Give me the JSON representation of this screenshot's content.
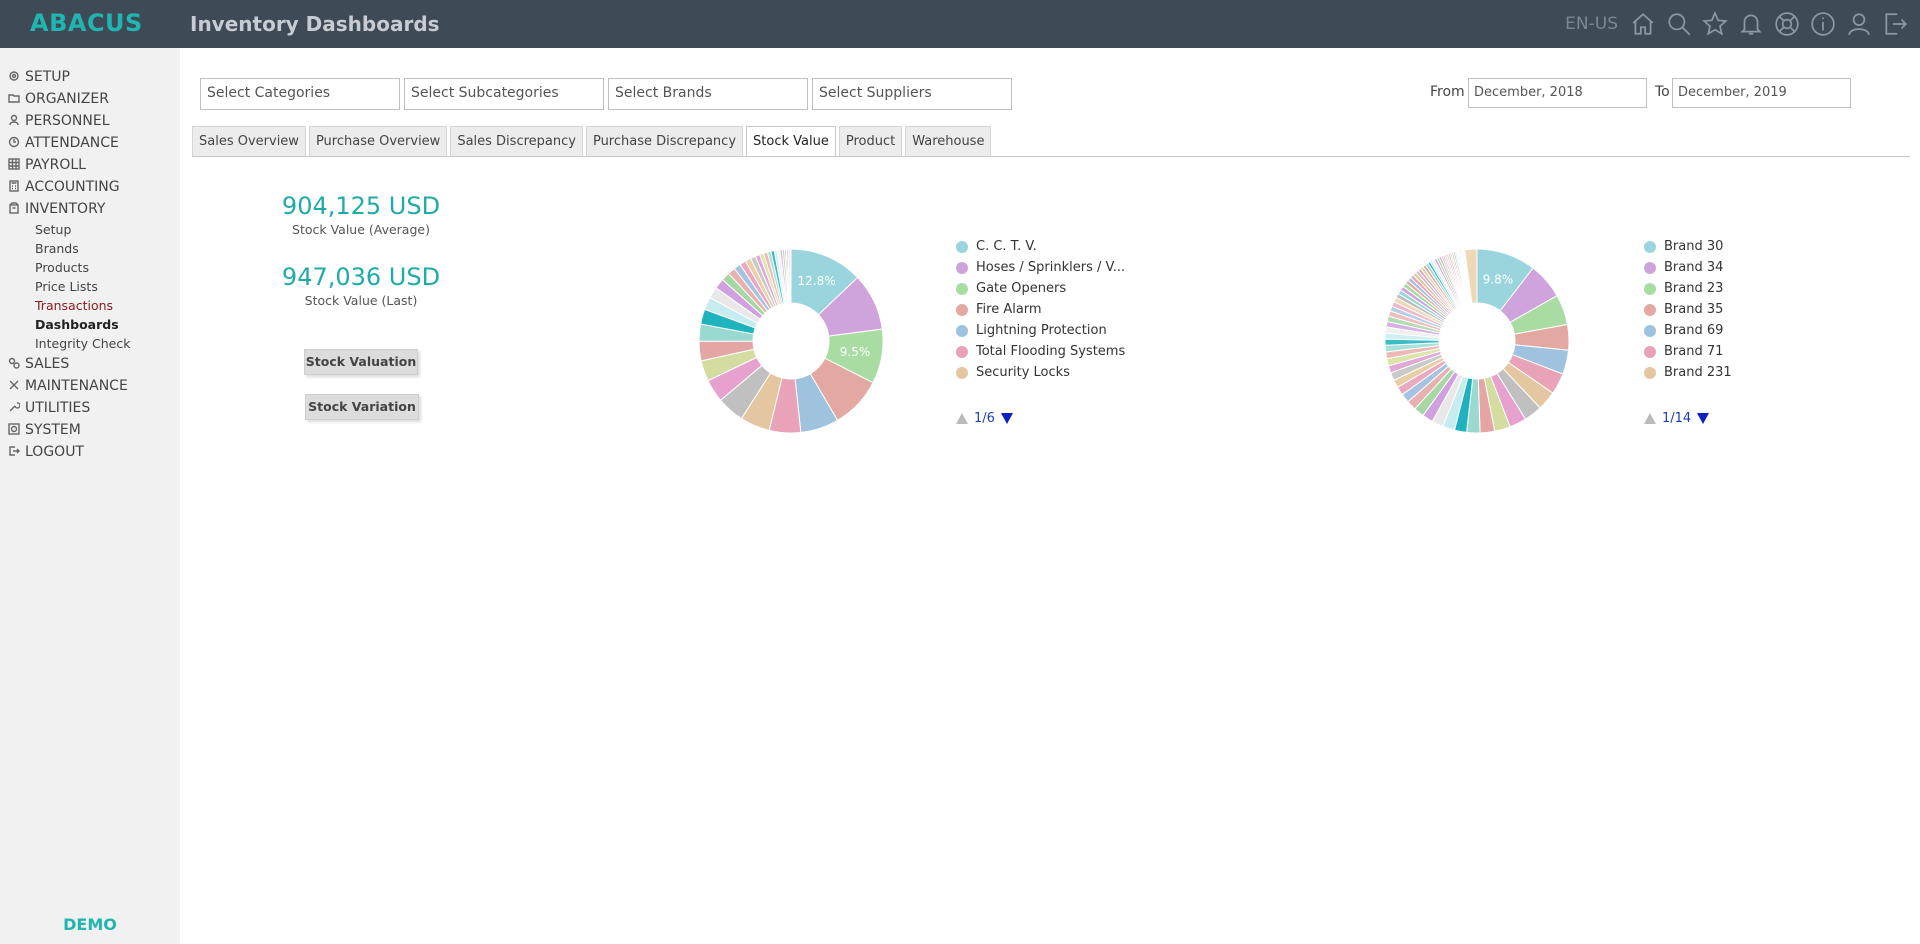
{
  "app": {
    "logo": "ABACUS",
    "title": "Inventory Dashboards",
    "language": "EN-US"
  },
  "topbar_icons": [
    "home-icon",
    "search-icon",
    "star-icon",
    "bell-icon",
    "lifebuoy-icon",
    "info-icon",
    "user-icon",
    "logout-icon"
  ],
  "sidebar": {
    "items": [
      {
        "label": "SETUP",
        "icon": "gear-icon"
      },
      {
        "label": "ORGANIZER",
        "icon": "folder-icon"
      },
      {
        "label": "PERSONNEL",
        "icon": "people-icon"
      },
      {
        "label": "ATTENDANCE",
        "icon": "clock-icon"
      },
      {
        "label": "PAYROLL",
        "icon": "grid-icon"
      },
      {
        "label": "ACCOUNTING",
        "icon": "calculator-icon"
      },
      {
        "label": "INVENTORY",
        "icon": "box-icon"
      },
      {
        "label": "SALES",
        "icon": "gears-icon"
      },
      {
        "label": "MAINTENANCE",
        "icon": "tools-icon"
      },
      {
        "label": "UTILITIES",
        "icon": "wrench-icon"
      },
      {
        "label": "SYSTEM",
        "icon": "system-icon"
      },
      {
        "label": "LOGOUT",
        "icon": "door-icon"
      }
    ],
    "inventory_sub": [
      {
        "label": "Setup"
      },
      {
        "label": "Brands"
      },
      {
        "label": "Products"
      },
      {
        "label": "Price Lists"
      },
      {
        "label": "Transactions"
      },
      {
        "label": "Dashboards"
      },
      {
        "label": "Integrity Check"
      }
    ],
    "footer": "DEMO"
  },
  "filters": {
    "categories_placeholder": "Select Categories",
    "subcategories_placeholder": "Select Subcategories",
    "brands_placeholder": "Select Brands",
    "suppliers_placeholder": "Select Suppliers",
    "from_label": "From",
    "from_value": "December, 2018",
    "to_label": "To",
    "to_value": "December, 2019"
  },
  "tabs": [
    {
      "label": "Sales Overview"
    },
    {
      "label": "Purchase Overview"
    },
    {
      "label": "Sales Discrepancy"
    },
    {
      "label": "Purchase Discrepancy"
    },
    {
      "label": "Stock Value",
      "active": true
    },
    {
      "label": "Product"
    },
    {
      "label": "Warehouse"
    }
  ],
  "kpis": {
    "average_value": "904,125 USD",
    "average_label": "Stock Value (Average)",
    "last_value": "947,036 USD",
    "last_label": "Stock Value (Last)"
  },
  "buttons": {
    "valuation": "Stock Valuation",
    "variation": "Stock Variation"
  },
  "chart_data": [
    {
      "type": "pie",
      "title": "",
      "legend_position": "right",
      "legend_page": "1/6",
      "categories": [
        "C. C. T. V.",
        "Hoses / Sprinklers / V...",
        "Gate Openers",
        "Fire Alarm",
        "Lightning Protection",
        "Total Flooding Systems",
        "Security Locks"
      ],
      "values": [
        12.8,
        10.0,
        9.5,
        9.0,
        6.7,
        5.5,
        5.2,
        4.8,
        4.0,
        3.6,
        3.4,
        3.0,
        2.6,
        2.2,
        2.0,
        1.8,
        1.5,
        1.3,
        1.2,
        1.1,
        1.0,
        0.9,
        0.8,
        0.7,
        0.7,
        0.6,
        0.6,
        0.5,
        0.5,
        0.4,
        0.4,
        0.3,
        0.3,
        0.3,
        0.2
      ],
      "labels_shown": [
        "12.8%",
        "",
        "9.5%"
      ],
      "colors": [
        "#9ad5de",
        "#cfa3db",
        "#a9dca3",
        "#e4a8a3",
        "#9fc2de",
        "#e9a3b8",
        "#e4c7a0",
        "#c0c0c0",
        "#e6a1cf",
        "#d4dca0",
        "#e5a5a5",
        "#9ad9d0",
        "#1fb3bf",
        "#c7ecf0",
        "#e8e8e8",
        "#d1a0df",
        "#a6d7a5",
        "#e7b1b1",
        "#a6c3e0",
        "#eba9c1",
        "#e8cfa6",
        "#c9c9c9",
        "#e3a9d6",
        "#dce4a9",
        "#efb8b8",
        "#a9e0d7",
        "#3bbdc8",
        "#cfeef2",
        "#f0f0f0",
        "#d8b0e3",
        "#b3dcb2",
        "#edc0c0",
        "#b6cfe6",
        "#f0b7cb",
        "#eed8b5"
      ]
    },
    {
      "type": "pie",
      "title": "",
      "legend_position": "right",
      "legend_page": "1/14",
      "categories": [
        "Brand 30",
        "Brand 34",
        "Brand 23",
        "Brand 35",
        "Brand 69",
        "Brand 71",
        "Brand 231"
      ],
      "values": [
        9.8,
        6.0,
        5.0,
        4.2,
        4.0,
        3.5,
        3.2,
        3.0,
        2.8,
        2.6,
        2.4,
        2.2,
        2.0,
        2.0,
        1.9,
        1.8,
        1.7,
        1.6,
        1.5,
        1.4,
        1.3,
        1.3,
        1.2,
        1.2,
        1.1,
        1.1,
        1.0,
        1.0,
        1.0,
        0.9,
        0.9,
        0.9,
        0.8,
        0.8,
        0.8,
        0.7,
        0.7,
        0.7,
        0.7,
        0.6,
        0.6,
        0.6,
        0.6,
        0.5,
        0.5,
        0.5,
        0.5,
        0.5,
        0.4,
        0.4,
        0.4,
        0.4,
        0.4,
        0.4,
        0.3,
        0.3,
        0.3,
        0.3,
        0.3,
        0.3,
        0.3,
        0.3,
        0.2,
        0.2,
        0.2,
        0.2,
        0.2,
        0.2,
        0.2,
        0.2,
        2.0
      ],
      "labels_shown": [
        "9.8%"
      ],
      "colors": [
        "#9ad5de",
        "#cfa3db",
        "#a9dca3",
        "#e4a8a3",
        "#9fc2de",
        "#e9a3b8",
        "#e4c7a0",
        "#c0c0c0",
        "#e6a1cf",
        "#d4dca0",
        "#e5a5a5",
        "#9ad9d0",
        "#1fb3bf",
        "#c7ecf0",
        "#e8e8e8",
        "#d1a0df",
        "#a6d7a5",
        "#e7b1b1",
        "#a6c3e0",
        "#eba9c1",
        "#e8cfa6",
        "#c9c9c9",
        "#e3a9d6",
        "#dce4a9",
        "#efb8b8",
        "#a9e0d7",
        "#3bbdc8",
        "#cfeef2",
        "#f0f0f0",
        "#d8b0e3",
        "#b3dcb2",
        "#edc0c0",
        "#b6cfe6",
        "#f0b7cb",
        "#eed8b5",
        "#bdbdbd"
      ]
    }
  ]
}
